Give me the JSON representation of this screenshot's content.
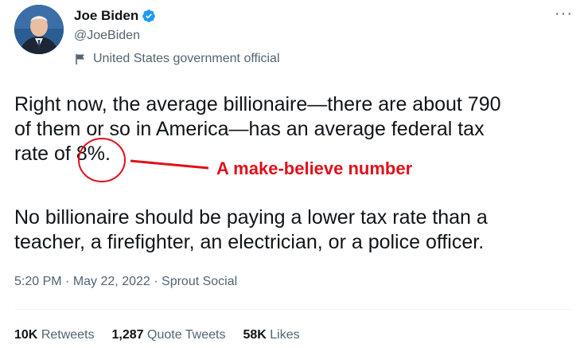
{
  "author": {
    "name": "Joe Biden",
    "handle": "@JoeBiden",
    "label": "United States government official"
  },
  "tweet": {
    "line1": "Right now, the average billionaire—there are about 790",
    "line2": "of them or so in America—has an average federal tax",
    "line3_prefix": "rate of ",
    "line3_highlight": "8%",
    "line3_suffix": ".",
    "para2_line1": "No billionaire should be paying a lower tax rate than a",
    "para2_line2": "teacher, a firefighter, an electrician, or a police officer."
  },
  "annotation": {
    "text": "A make-believe number",
    "color": "#e0101a"
  },
  "meta": {
    "time": "5:20 PM",
    "date": "May 22, 2022",
    "source": "Sprout Social",
    "sep": "·"
  },
  "stats": {
    "retweets_num": "10K",
    "retweets_label": "Retweets",
    "quotes_num": "1,287",
    "quotes_label": "Quote Tweets",
    "likes_num": "58K",
    "likes_label": "Likes"
  },
  "colors": {
    "verified": "#1d9bf0",
    "secondary_text": "#536471"
  }
}
